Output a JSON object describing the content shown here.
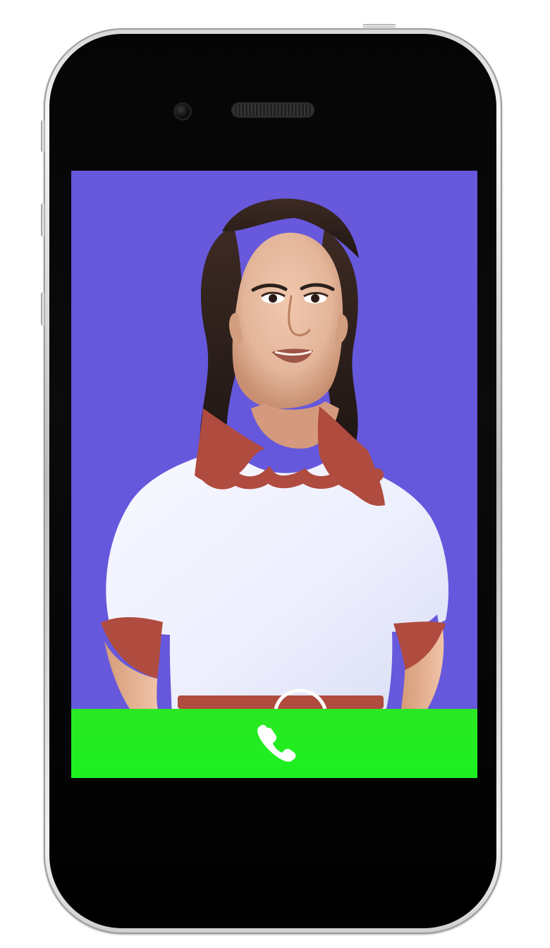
{
  "device": {
    "type": "phone",
    "screen_background": "#6659db",
    "call_bar_color": "#1cf11f",
    "shell_color": "#050505"
  },
  "incoming_call": {
    "action": "answer",
    "icon": "phone-icon",
    "icon_color": "#ffffff"
  }
}
